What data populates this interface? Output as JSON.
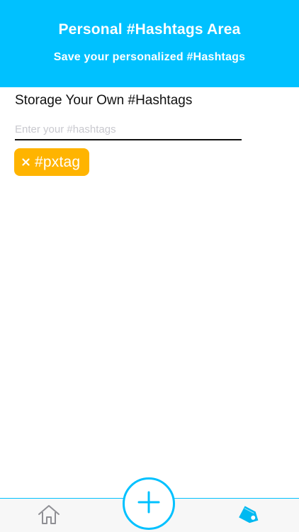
{
  "header": {
    "title": "Personal #Hashtags Area",
    "subtitle": "Save your personalized #Hashtags"
  },
  "main": {
    "section_title": "Storage Your Own #Hashtags",
    "input": {
      "value": "",
      "placeholder": "Enter your #hashtags"
    },
    "tags": [
      {
        "label": "#pxtag",
        "remove_icon": "close-icon"
      }
    ]
  },
  "tabbar": {
    "items": [
      {
        "name": "home",
        "icon": "home-icon",
        "active": false
      },
      {
        "name": "add",
        "icon": "plus-icon",
        "active": false
      },
      {
        "name": "hashtags",
        "icon": "tag-icon",
        "active": true
      }
    ]
  },
  "colors": {
    "primary": "#00c1ff",
    "tag": "#ffb400",
    "text": "#111111",
    "placeholder": "#c9c9cf",
    "tabbar_background": "#f7f7f7"
  }
}
